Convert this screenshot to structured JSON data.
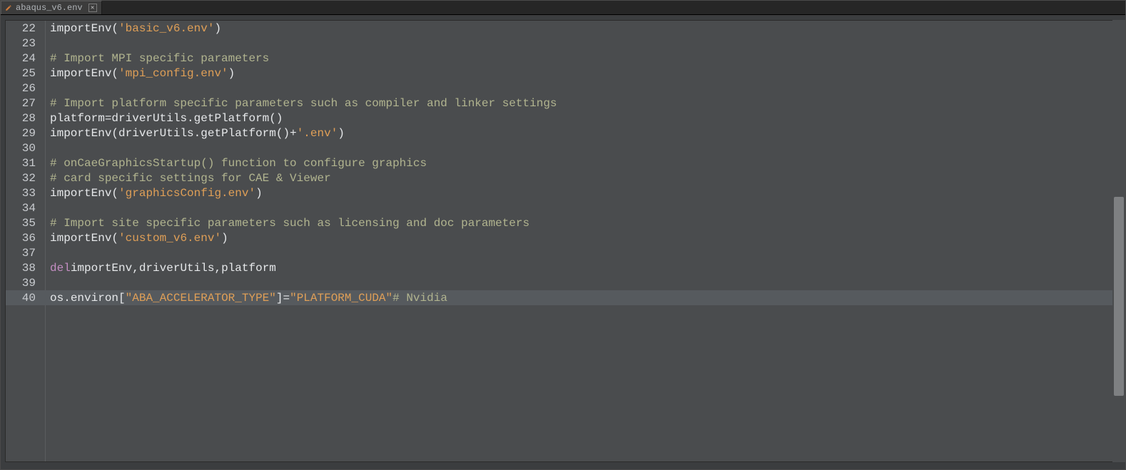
{
  "tab": {
    "filename": "abaqus_v6.env",
    "modified": true,
    "close_tooltip": "Close"
  },
  "editor": {
    "first_line_number": 22,
    "current_line_number": 40,
    "lines": [
      {
        "n": 22,
        "tokens": [
          [
            "func",
            "importEnv"
          ],
          [
            "punct",
            "("
          ],
          [
            "str",
            "'basic_v6.env'"
          ],
          [
            "punct",
            ")"
          ]
        ]
      },
      {
        "n": 23,
        "tokens": []
      },
      {
        "n": 24,
        "tokens": [
          [
            "comment",
            "# Import MPI specific parameters"
          ]
        ]
      },
      {
        "n": 25,
        "tokens": [
          [
            "func",
            "importEnv"
          ],
          [
            "punct",
            "("
          ],
          [
            "str",
            "'mpi_config.env'"
          ],
          [
            "punct",
            ")"
          ]
        ]
      },
      {
        "n": 26,
        "tokens": []
      },
      {
        "n": 27,
        "tokens": [
          [
            "comment",
            "# Import platform specific parameters such as compiler and linker settings"
          ]
        ]
      },
      {
        "n": 28,
        "tokens": [
          [
            "ident",
            "platform "
          ],
          [
            "op",
            "="
          ],
          [
            "ident",
            " driverUtils"
          ],
          [
            "punct",
            "."
          ],
          [
            "func",
            "getPlatform"
          ],
          [
            "punct",
            "()"
          ]
        ]
      },
      {
        "n": 29,
        "tokens": [
          [
            "func",
            "importEnv"
          ],
          [
            "punct",
            "("
          ],
          [
            "ident",
            "driverUtils"
          ],
          [
            "punct",
            "."
          ],
          [
            "func",
            "getPlatform"
          ],
          [
            "punct",
            "() "
          ],
          [
            "op",
            "+"
          ],
          [
            "punct",
            " "
          ],
          [
            "str",
            "'.env'"
          ],
          [
            "punct",
            ")"
          ]
        ]
      },
      {
        "n": 30,
        "tokens": []
      },
      {
        "n": 31,
        "tokens": [
          [
            "comment",
            "# onCaeGraphicsStartup() function to configure graphics"
          ]
        ]
      },
      {
        "n": 32,
        "tokens": [
          [
            "comment",
            "# card specific settings for CAE & Viewer"
          ]
        ]
      },
      {
        "n": 33,
        "tokens": [
          [
            "func",
            "importEnv"
          ],
          [
            "punct",
            "("
          ],
          [
            "str",
            "'graphicsConfig.env'"
          ],
          [
            "punct",
            ")"
          ]
        ]
      },
      {
        "n": 34,
        "tokens": []
      },
      {
        "n": 35,
        "tokens": [
          [
            "comment",
            "# Import site specific parameters such as licensing and doc parameters"
          ]
        ]
      },
      {
        "n": 36,
        "tokens": [
          [
            "func",
            "importEnv"
          ],
          [
            "punct",
            "("
          ],
          [
            "str",
            "'custom_v6.env'"
          ],
          [
            "punct",
            ")"
          ]
        ]
      },
      {
        "n": 37,
        "tokens": []
      },
      {
        "n": 38,
        "tokens": [
          [
            "keyword",
            "del"
          ],
          [
            "ident",
            " importEnv"
          ],
          [
            "punct",
            ","
          ],
          [
            "ident",
            " driverUtils"
          ],
          [
            "punct",
            ","
          ],
          [
            "ident",
            " platform"
          ]
        ]
      },
      {
        "n": 39,
        "tokens": []
      },
      {
        "n": 40,
        "tokens": [
          [
            "ident",
            "os"
          ],
          [
            "punct",
            "."
          ],
          [
            "ident",
            "environ"
          ],
          [
            "punct",
            "["
          ],
          [
            "str",
            "\"ABA_ACCELERATOR_TYPE\""
          ],
          [
            "punct",
            "]"
          ],
          [
            "op",
            "="
          ],
          [
            "str",
            "\"PLATFORM_CUDA\""
          ],
          [
            "ident",
            " "
          ],
          [
            "comment",
            "# Nvidia"
          ]
        ]
      }
    ]
  },
  "scrollbar": {
    "thumb_top_pct": 40,
    "thumb_height_pct": 45
  },
  "colors": {
    "background": "#4a4c4e",
    "string": "#df9f57",
    "comment": "#b1b48f",
    "keyword": "#c48ec3",
    "default": "#e6e8ea",
    "current_line": "#565a5e"
  }
}
